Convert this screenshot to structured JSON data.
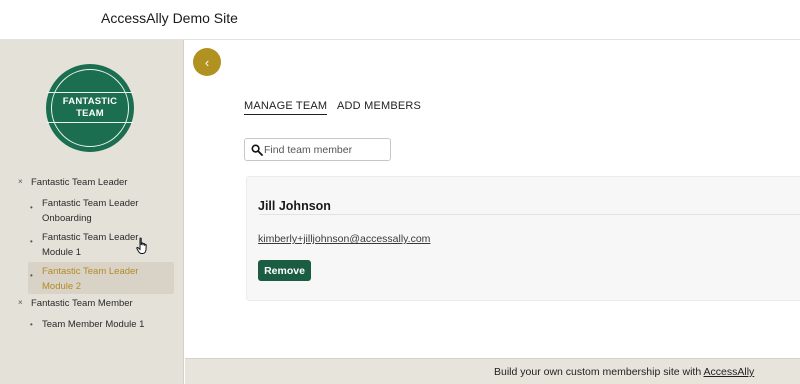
{
  "header": {
    "site_title": "AccessAlly Demo Site"
  },
  "sidebar": {
    "badge_line1": "FANTASTIC",
    "badge_line2": "TEAM",
    "items": [
      {
        "label": "Fantastic Team Leader",
        "bullet": "×"
      },
      {
        "label": "Fantastic Team Leader Onboarding",
        "line1": "Fantastic Team Leader",
        "line2": "Onboarding",
        "bullet": "•"
      },
      {
        "label": "Fantastic Team Leader Module 1",
        "line1": "Fantastic Team Leader",
        "line2": "Module 1",
        "bullet": "•"
      },
      {
        "label": "Fantastic Team Leader Module 2",
        "line1": "Fantastic Team Leader",
        "line2": "Module 2",
        "bullet": "•",
        "active": true
      },
      {
        "label": "Fantastic Team Member",
        "bullet": "×"
      },
      {
        "label": "Team Member Module 1",
        "bullet": "•"
      }
    ]
  },
  "main": {
    "back_icon": "‹",
    "tabs": [
      {
        "label": "MANAGE TEAM",
        "active": true
      },
      {
        "label": "ADD MEMBERS",
        "active": false
      }
    ],
    "search": {
      "placeholder": "Find team member",
      "value": ""
    },
    "member": {
      "name": "Jill Johnson",
      "email": "kimberly+jilljohnson@accessally.com",
      "remove_label": "Remove"
    }
  },
  "footer": {
    "text": "Build your own custom membership site with ",
    "link": "AccessAlly"
  },
  "colors": {
    "brand_green": "#1b6e4f",
    "button_green": "#1a5d42",
    "gold": "#b1911f",
    "active_nav_text": "#b58a28",
    "sidebar_bg": "#e4e1d9"
  },
  "icons": [
    "chevron-left-icon",
    "search-icon",
    "hand-cursor-icon"
  ]
}
